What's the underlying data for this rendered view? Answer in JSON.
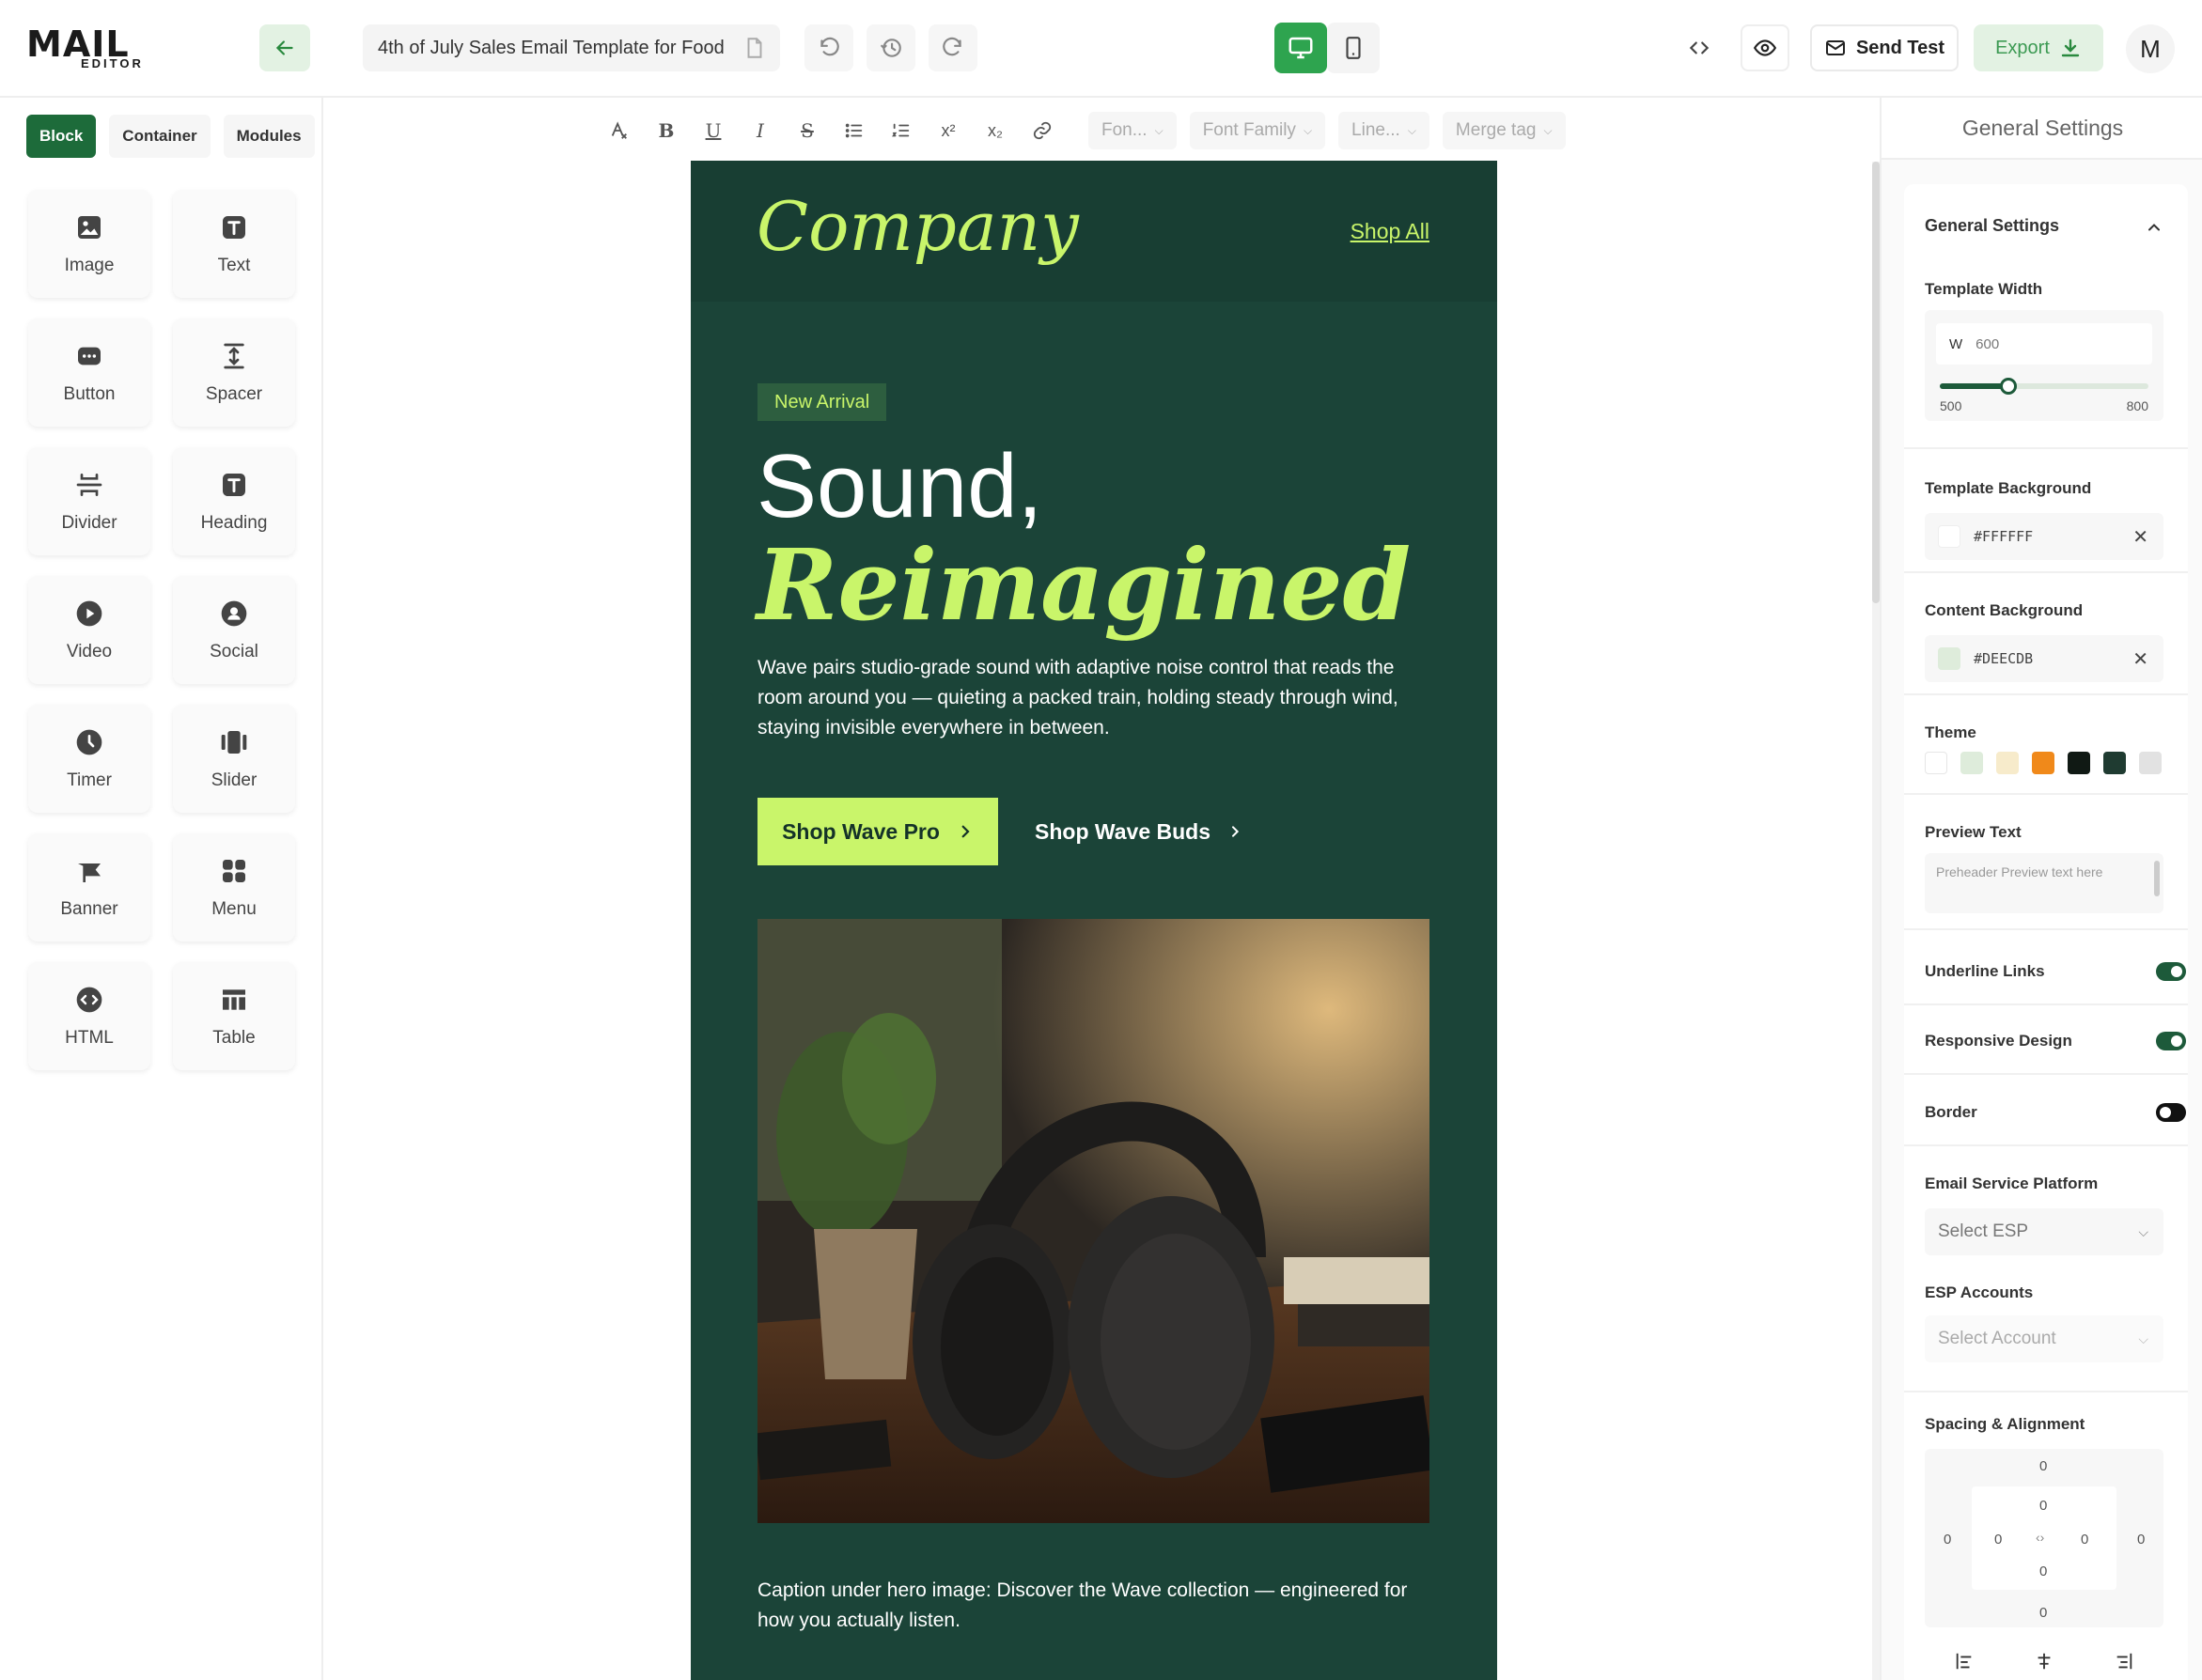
{
  "app": {
    "logo_word": "MAIL",
    "logo_sub": "EDITOR",
    "document_title": "4th of July Sales Email Template for Food",
    "send_test_label": "Send Test",
    "export_label": "Export",
    "avatar_initial": "M"
  },
  "left_panel": {
    "tabs": [
      {
        "label": "Block",
        "active": true
      },
      {
        "label": "Container",
        "active": false
      },
      {
        "label": "Modules",
        "active": false
      }
    ],
    "blocks": [
      {
        "label": "Image",
        "icon": "image-icon"
      },
      {
        "label": "Text",
        "icon": "text-icon"
      },
      {
        "label": "Button",
        "icon": "button-icon"
      },
      {
        "label": "Spacer",
        "icon": "spacer-icon"
      },
      {
        "label": "Divider",
        "icon": "divider-icon"
      },
      {
        "label": "Heading",
        "icon": "heading-icon"
      },
      {
        "label": "Video",
        "icon": "video-icon"
      },
      {
        "label": "Social",
        "icon": "social-icon"
      },
      {
        "label": "Timer",
        "icon": "timer-icon"
      },
      {
        "label": "Slider",
        "icon": "slider-icon"
      },
      {
        "label": "Banner",
        "icon": "banner-icon"
      },
      {
        "label": "Menu",
        "icon": "menu-icon"
      },
      {
        "label": "HTML",
        "icon": "html-icon"
      },
      {
        "label": "Table",
        "icon": "table-icon"
      }
    ]
  },
  "format_toolbar": {
    "font_size": "Fon...",
    "font_family": "Font Family",
    "line_height": "Line...",
    "merge_tag": "Merge tag"
  },
  "email": {
    "logo": "Company",
    "shop_all": "Shop All",
    "badge": "New Arrival",
    "headline_line1": "Sound,",
    "headline_line2": "Reimagined",
    "body": "Wave pairs studio-grade sound with adaptive noise control that reads the room around you — quieting a packed train, holding steady through wind, staying invisible everywhere in between.",
    "cta_primary": "Shop Wave Pro",
    "cta_secondary": "Shop Wave Buds",
    "caption": "Caption under hero image: Discover the Wave collection — engineered for how you actually listen.",
    "colors": {
      "background": "#1b4438",
      "header": "#183e33",
      "accent": "#c9f56a"
    }
  },
  "right_panel": {
    "title": "General Settings",
    "section_title": "General Settings",
    "template_width": {
      "label": "Template Width",
      "prefix": "W",
      "value": "600",
      "min": "500",
      "max": "800",
      "fraction": 0.33
    },
    "template_background": {
      "label": "Template Background",
      "value": "#FFFFFF"
    },
    "content_background": {
      "label": "Content Background",
      "value": "#DEECDB"
    },
    "theme": {
      "label": "Theme",
      "swatches": [
        "#ffffff",
        "#deecdb",
        "#f7ebcb",
        "#f0891a",
        "#101914",
        "#1f3b31",
        "#e2e2e2"
      ]
    },
    "preview_text": {
      "label": "Preview Text",
      "placeholder": "Preheader Preview text here"
    },
    "underline_links": {
      "label": "Underline Links",
      "on": true
    },
    "responsive_design": {
      "label": "Responsive Design",
      "on": true
    },
    "border": {
      "label": "Border",
      "on": false
    },
    "esp": {
      "label": "Email Service Platform",
      "placeholder": "Select ESP"
    },
    "esp_accounts": {
      "label": "ESP Accounts",
      "placeholder": "Select Account"
    },
    "spacing": {
      "label": "Spacing & Alignment",
      "outer_top": "0",
      "outer_bottom": "0",
      "outer_left": "0",
      "outer_right": "0",
      "inner_top": "0",
      "inner_bottom": "0",
      "inner_left": "0",
      "inner_right": "0"
    }
  }
}
